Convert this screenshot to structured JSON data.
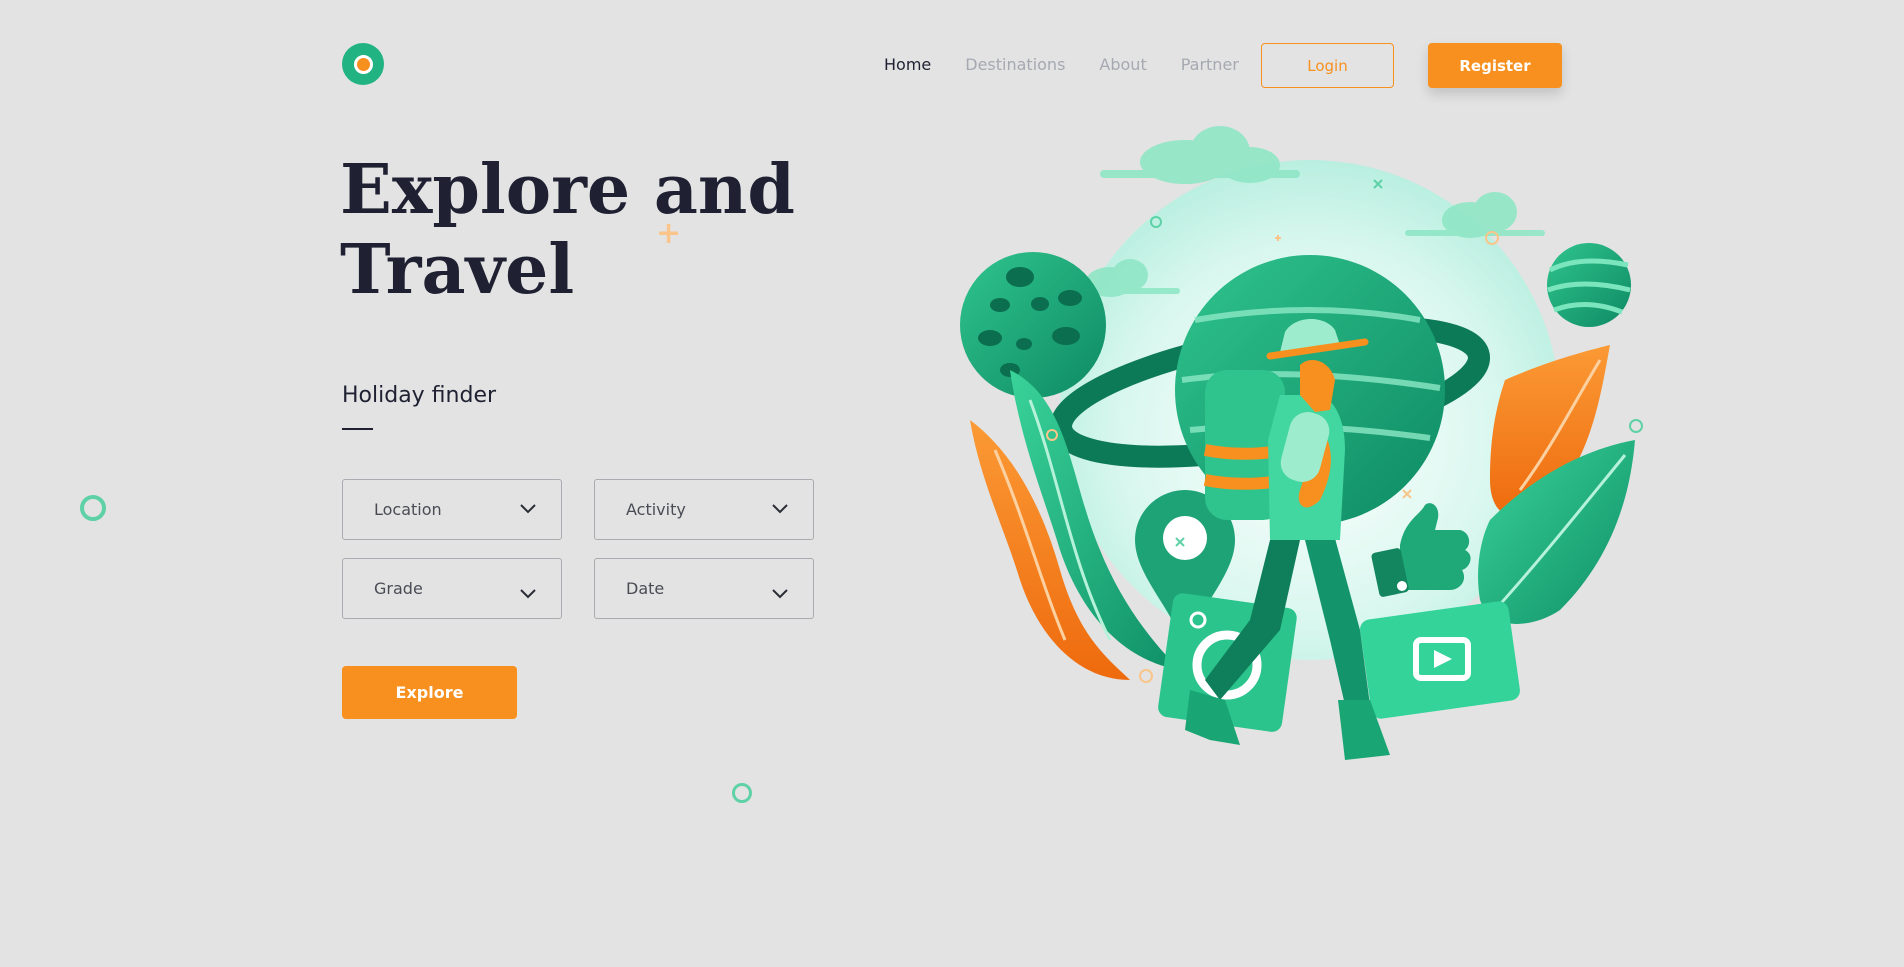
{
  "nav": {
    "items": [
      {
        "label": "Home",
        "active": true
      },
      {
        "label": "Destinations",
        "active": false
      },
      {
        "label": "About",
        "active": false
      },
      {
        "label": "Partner",
        "active": false
      }
    ],
    "login_label": "Login",
    "register_label": "Register"
  },
  "hero": {
    "title_line1": "Explore and",
    "title_line2": "Travel"
  },
  "finder": {
    "title": "Holiday finder",
    "selects": {
      "location": "Location",
      "activity": "Activity",
      "grade": "Grade",
      "date": "Date"
    },
    "explore_label": "Explore"
  },
  "colors": {
    "background": "#e3e3e3",
    "accent_orange": "#f7901e",
    "brand_green": "#22b383",
    "text_dark": "#1f2133",
    "nav_inactive": "#a6a9b2"
  },
  "icons": {
    "logo": "circle-logo-icon",
    "select_chevron": "chevron-down-icon"
  }
}
